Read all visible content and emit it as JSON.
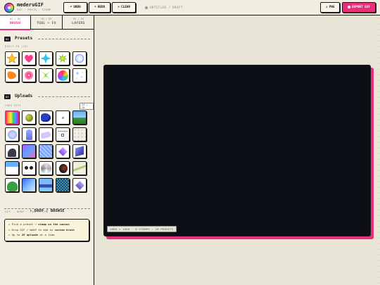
{
  "app": {
    "name": "mederuGIF",
    "tagline": "GIF · POSTS · STAMP",
    "doc_title": "UNTITLED / DRAFT"
  },
  "toolbar": {
    "undo": "UNDO",
    "redo": "REDO",
    "clear": "CLEAR",
    "png": "PNG",
    "export": "EXPORT GIF",
    "undo_icon": "↶",
    "redo_icon": "↷",
    "clear_icon": "✕",
    "png_icon": "↓"
  },
  "tabs": [
    {
      "num": "01 / 03",
      "label": "BRUSH"
    },
    {
      "num": "02 / 03",
      "label": "TOOL + FX"
    },
    {
      "num": "03 / 03",
      "label": "LAYERS"
    }
  ],
  "presets": {
    "num": "01",
    "title": "Presets",
    "sublabel": "BUILT-IN (20)",
    "items": [
      "star-icon",
      "heart-icon",
      "sparkle-icon",
      "burst-icon",
      "ring-icon",
      "blob-icon",
      "flower-icon",
      "cross-sparkle-icon",
      "color-wheel-icon",
      "glitter-icon"
    ]
  },
  "uploads": {
    "num": "02",
    "title": "Uploads",
    "sublabel": "YOUR GIFS",
    "counter": "25 / 25",
    "items": [
      "rainbow-gif",
      "green-ball-gif",
      "blue-blob-gif",
      "white-dot-gif",
      "landscape-gif",
      "dots-gif",
      "figure-gif",
      "sticker-gif",
      "window-gif",
      "stars-gif",
      "bird-gif",
      "purple-gif",
      "pattern-gif",
      "diamond-gif",
      "cube-gif",
      "blue-tile-gif",
      "eyes-gif",
      "disc-gif",
      "face-gif",
      "stripes-gif",
      "frog-gif",
      "sky-gif",
      "wave-gif",
      "blue-pattern-gif",
      "gem-gif"
    ],
    "drop_label": "↑ DROP / BROWSE",
    "formats": "GIF · WEBP · PNG · JPG"
  },
  "tips": [
    {
      "pre": "▸ Pick a preset → ",
      "bold": "stamp on the canvas",
      "post": ""
    },
    {
      "pre": "▸ Drop GIF / WebP to add as ",
      "bold": "custom brush",
      "post": ""
    },
    {
      "pre": "▸ Up to ",
      "bold": "25 uploads",
      "post": " at a time"
    }
  ],
  "canvas": {
    "status": "1000 × 1000 · 0 STAMPS · 20 PRESETS"
  },
  "colors": {
    "accent": "#e8307a",
    "canvas_bg": "#0c0f16",
    "panel_bg": "#f1ede1"
  }
}
